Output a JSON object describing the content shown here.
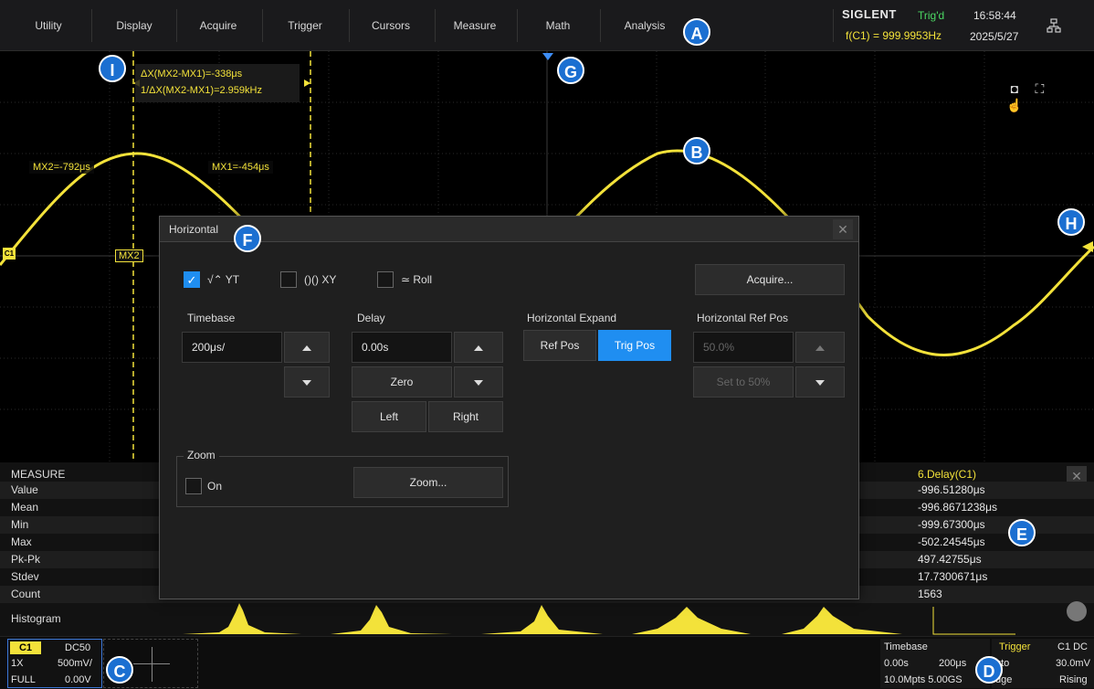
{
  "menu": {
    "items": [
      "Utility",
      "Display",
      "Acquire",
      "Trigger",
      "Cursors",
      "Measure",
      "Math",
      "Analysis"
    ]
  },
  "status": {
    "brand": "SIGLENT",
    "trigger_state": "Trig'd",
    "frequency": "f(C1) = 999.9953Hz",
    "time": "16:58:44",
    "date": "2025/5/27"
  },
  "annotations": {
    "a": "A",
    "b": "B",
    "c": "C",
    "d": "D",
    "e": "E",
    "f": "F",
    "g": "G",
    "h": "H",
    "i": "I"
  },
  "cursors": {
    "delta_x": "ΔX(MX2-MX1)=-338μs",
    "inv_delta_x": "1/ΔX(MX2-MX1)=2.959kHz",
    "mx2_value": "MX2=-792μs",
    "mx1_value": "MX1=-454μs",
    "mx2_tag": "MX2",
    "channel_marker": "C1"
  },
  "dialog": {
    "title": "Horizontal",
    "mode_yt": "YT",
    "mode_xy": "XY",
    "mode_roll": "Roll",
    "acquire_button": "Acquire...",
    "timebase_label": "Timebase",
    "timebase_value": "200μs/",
    "delay_label": "Delay",
    "delay_value": "0.00s",
    "zero_button": "Zero",
    "left_button": "Left",
    "right_button": "Right",
    "expand_label": "Horizontal Expand",
    "ref_pos_button": "Ref Pos",
    "trig_pos_button": "Trig Pos",
    "ref_pos_label": "Horizontal Ref Pos",
    "ref_pos_value": "50.0%",
    "set_50_button": "Set to 50%",
    "zoom_group": "Zoom",
    "zoom_on_label": "On",
    "zoom_button": "Zoom..."
  },
  "measure": {
    "title": "MEASURE",
    "column_header": "6.Delay(C1)",
    "rows": [
      {
        "name": "Value",
        "value": "-996.51280μs"
      },
      {
        "name": "Mean",
        "value": "-996.8671238μs"
      },
      {
        "name": "Min",
        "value": "-999.67300μs"
      },
      {
        "name": "Max",
        "value": "-502.24545μs"
      },
      {
        "name": "Pk-Pk",
        "value": "497.42755μs"
      },
      {
        "name": "Stdev",
        "value": "17.7300671μs"
      },
      {
        "name": "Count",
        "value": "1563"
      }
    ],
    "histogram_label": "Histogram"
  },
  "channel": {
    "name": "C1",
    "coupling": "DC50",
    "probe": "1X",
    "scale": "500mV/",
    "bandwidth": "FULL",
    "offset": "0.00V"
  },
  "timebase": {
    "title": "Timebase",
    "delay": "0.00s",
    "scale": "200μs",
    "memory": "10.0Mpts 5.00GS",
    "mode": "uto"
  },
  "trigger": {
    "title": "Trigger",
    "source": "C1 DC",
    "level": "30.0mV",
    "type": "dge",
    "slope": "Rising"
  },
  "colors": {
    "trace": "#f3e23a",
    "accent": "#1f8ef1",
    "annotation": "#1b6fd1"
  }
}
